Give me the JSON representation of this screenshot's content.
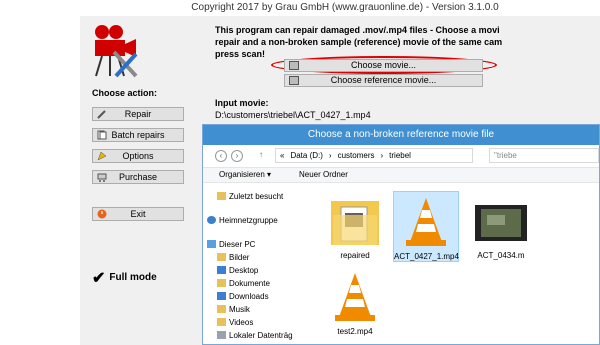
{
  "window": {
    "title": "Copyright 2017 by Grau GmbH (www.grauonline.de) - Version 3.1.0.0"
  },
  "sidebar": {
    "choose_action": "Choose action:",
    "buttons": {
      "repair": "Repair",
      "batch": "Batch repairs",
      "options": "Options",
      "purchase": "Purchase",
      "exit": "Exit"
    },
    "full_mode": "Full mode"
  },
  "main": {
    "info": "This program can repair damaged .mov/.mp4 files - Choose a movi\nrepair and a non-broken sample (reference) movie of the same cam\npress scan!",
    "choose_movie": "Choose movie...",
    "choose_reference": "Choose reference movie...",
    "input_label": "Input movie:",
    "input_path": "D:\\customers\\triebel\\ACT_0427_1.mp4"
  },
  "dialog": {
    "title": "Choose a non-broken reference movie file",
    "breadcrumb": [
      "«",
      "Data (D:)",
      "›",
      "customers",
      "›",
      "triebel"
    ],
    "search_placeholder": "\"triebe",
    "toolbar": {
      "organize": "Organisieren ▾",
      "new_folder": "Neuer Ordner"
    },
    "nav": {
      "recent": "Zuletzt besucht",
      "homegroup": "Heimnetzgruppe",
      "this_pc": "Dieser PC",
      "pictures": "Bilder",
      "desktop": "Desktop",
      "documents": "Dokumente",
      "downloads": "Downloads",
      "music": "Musik",
      "videos": "Videos",
      "local_disk": "Lokaler Datenträg"
    },
    "files": [
      {
        "name": "repaired",
        "type": "folder"
      },
      {
        "name": "ACT_0427_1.mp4",
        "type": "vlc",
        "selected": true
      },
      {
        "name": "ACT_0434.m",
        "type": "video"
      },
      {
        "name": "test2.mp4",
        "type": "vlc"
      }
    ]
  },
  "colors": {
    "accent": "#3f8fd1",
    "highlight_oval": "#e00000",
    "selected_file": "#cce8ff",
    "vlc_orange": "#f08a00"
  }
}
